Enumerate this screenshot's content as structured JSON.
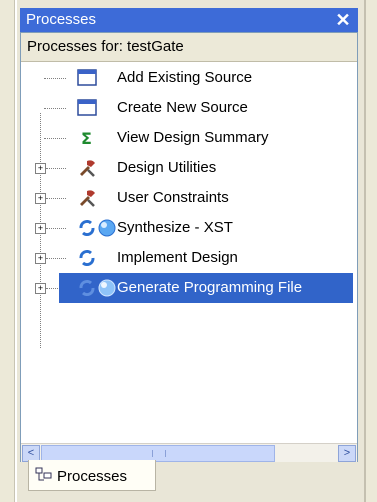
{
  "panel": {
    "title": "Processes",
    "close_label": "✕",
    "subheader": "Processes for: testGate",
    "items": [
      {
        "label": "Add Existing Source",
        "icon": "window-icon",
        "expandable": false
      },
      {
        "label": "Create New Source",
        "icon": "window-icon",
        "expandable": false
      },
      {
        "label": "View Design Summary",
        "icon": "sigma-icon",
        "expandable": false
      },
      {
        "label": "Design Utilities",
        "icon": "tools-icon",
        "expandable": true
      },
      {
        "label": "User Constraints",
        "icon": "tools-icon",
        "expandable": true
      },
      {
        "label": "Synthesize - XST",
        "icon": "process-icon",
        "expandable": true
      },
      {
        "label": "Implement Design",
        "icon": "process-icon",
        "expandable": true
      },
      {
        "label": "Generate Programming File",
        "icon": "process-icon",
        "expandable": true,
        "selected": true
      }
    ],
    "expand_glyph": "+",
    "tab_label": "Processes"
  },
  "scroll": {
    "left_glyph": "<",
    "right_glyph": ">"
  },
  "colors": {
    "titlebar": "#3d6bd8",
    "selection": "#3164c9"
  }
}
